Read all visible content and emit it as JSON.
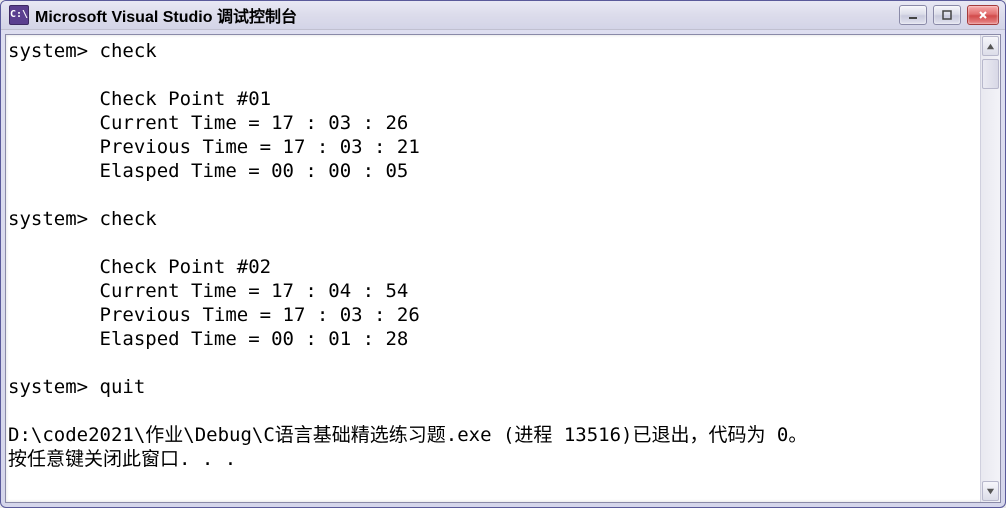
{
  "window": {
    "title": "Microsoft Visual Studio 调试控制台",
    "app_icon_text": "C:\\"
  },
  "console": {
    "lines": [
      "system> check",
      "",
      "        Check Point #01",
      "        Current Time = 17 : 03 : 26",
      "        Previous Time = 17 : 03 : 21",
      "        Elasped Time = 00 : 00 : 05",
      "",
      "system> check",
      "",
      "        Check Point #02",
      "        Current Time = 17 : 04 : 54",
      "        Previous Time = 17 : 03 : 26",
      "        Elasped Time = 00 : 01 : 28",
      "",
      "system> quit",
      "",
      "D:\\code2021\\作业\\Debug\\C语言基础精选练习题.exe (进程 13516)已退出，代码为 0。",
      "按任意键关闭此窗口. . ."
    ]
  }
}
